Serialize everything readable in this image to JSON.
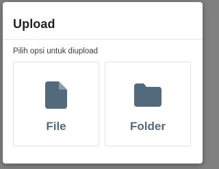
{
  "dialog": {
    "title": "Upload",
    "subtitle": "Pilih opsi untuk diupload",
    "options": [
      {
        "label": "File",
        "icon": "file-icon"
      },
      {
        "label": "Folder",
        "icon": "folder-icon"
      }
    ]
  },
  "colors": {
    "backdrop": "#808080",
    "icon": "#53697c",
    "label": "#53697c",
    "title": "#1f1f1f"
  }
}
